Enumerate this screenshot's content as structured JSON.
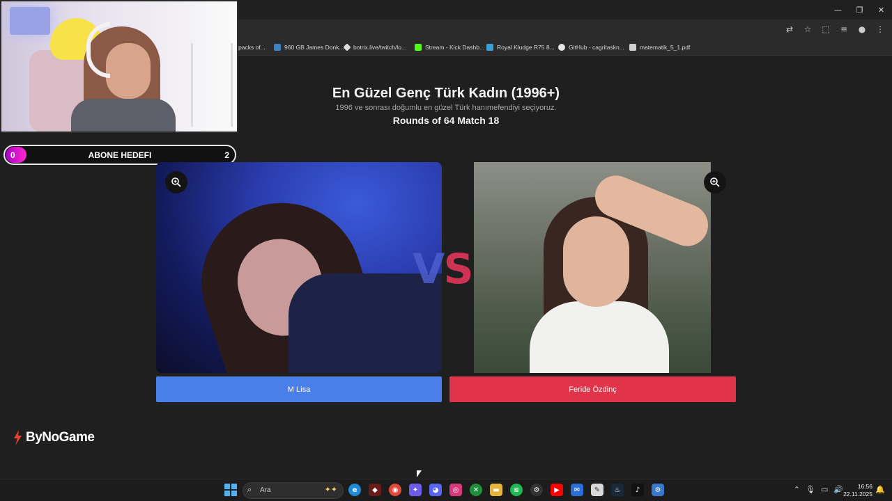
{
  "window": {
    "minimize": "—",
    "restore": "❐",
    "close": "✕"
  },
  "toolbar": {
    "translate_icon": "translate-icon",
    "star_icon": "star-icon",
    "extensions_icon": "extensions-icon",
    "media_icon": "media-icon",
    "profile_icon": "profile-icon",
    "menu_icon": "menu-icon"
  },
  "bookmarks": [
    {
      "label": "packs of...",
      "icon_color": "#2b2b2b"
    },
    {
      "label": "960 GB James Donk...",
      "icon_color": "#3b82c4"
    },
    {
      "label": "botrix.live/twitch/lo...",
      "icon_color": "#dddddd"
    },
    {
      "label": "Stream - Kick Dashb...",
      "icon_color": "#53fc18"
    },
    {
      "label": "Royal Kludge R75 8...",
      "icon_color": "#3aa0d8"
    },
    {
      "label": "GitHub - cagritaskn...",
      "icon_color": "#e6e6e6"
    },
    {
      "label": "matematik_5_1.pdf",
      "icon_color": "#cfcfcf"
    }
  ],
  "goal": {
    "start": "0",
    "label": "ABONE HEDEFI",
    "end": "2",
    "accent": "#e21bd0"
  },
  "header": {
    "title": "En Güzel Genç Türk Kadın (1996+)",
    "subtitle": "1996 ve sonrası doğumlu en güzel Türk hanımefendiyi seçiyoruz.",
    "round": "Rounds of 64 Match 18"
  },
  "match": {
    "vs_v": "V",
    "vs_s": "S",
    "left": {
      "name": "M Lisa",
      "color": "#4a7fea"
    },
    "right": {
      "name": "Feride Özdinç",
      "color": "#e0344a"
    }
  },
  "brand": {
    "name": "ByNoGame"
  },
  "taskbar": {
    "search_placeholder": "Ara",
    "time": "16:56",
    "date": "22.11.2025",
    "apps": [
      {
        "name": "edge-icon",
        "glyph": "e",
        "color": "#1f8ad6"
      },
      {
        "name": "app-icon",
        "glyph": "◆",
        "color": "#6b1a1a"
      },
      {
        "name": "chrome-icon",
        "glyph": "◉",
        "color": "#e04a3a"
      },
      {
        "name": "copilot-icon",
        "glyph": "✦",
        "color": "#6c5ce7"
      },
      {
        "name": "discord-icon",
        "glyph": "◕",
        "color": "#5865f2"
      },
      {
        "name": "instagram-icon",
        "glyph": "◎",
        "color": "#d63a7a"
      },
      {
        "name": "xbox-icon",
        "glyph": "✕",
        "color": "#1e8f3a"
      },
      {
        "name": "folder-icon",
        "glyph": "▬",
        "color": "#e6b43a"
      },
      {
        "name": "spotify-icon",
        "glyph": "≋",
        "color": "#1db954"
      },
      {
        "name": "steam-alt-icon",
        "glyph": "⚙",
        "color": "#333333"
      },
      {
        "name": "youtube-icon",
        "glyph": "▶",
        "color": "#ff0000"
      },
      {
        "name": "mail-icon",
        "glyph": "✉",
        "color": "#2a6fd6"
      },
      {
        "name": "notes-icon",
        "glyph": "✎",
        "color": "#d9d9d9"
      },
      {
        "name": "steam-icon",
        "glyph": "♨",
        "color": "#1b2838"
      },
      {
        "name": "tiktok-icon",
        "glyph": "♪",
        "color": "#111111"
      },
      {
        "name": "settings-icon",
        "glyph": "⚙",
        "color": "#3a78c9"
      }
    ]
  }
}
